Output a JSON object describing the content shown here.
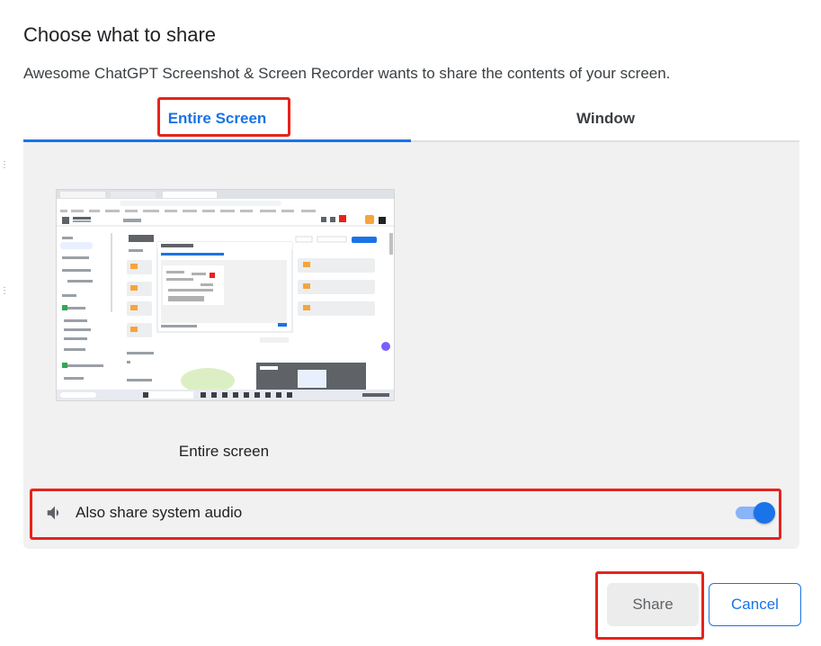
{
  "dialog": {
    "title": "Choose what to share",
    "subtitle": "Awesome ChatGPT Screenshot & Screen Recorder wants to share the contents of your screen."
  },
  "tabs": [
    {
      "label": "Entire Screen",
      "active": true
    },
    {
      "label": "Window",
      "active": false
    }
  ],
  "screen_source": {
    "label": "Entire screen"
  },
  "audio": {
    "label": "Also share system audio",
    "enabled": true,
    "icon": "speaker-icon"
  },
  "buttons": {
    "share": "Share",
    "cancel": "Cancel"
  },
  "colors": {
    "accent": "#1a73e8",
    "highlight": "#e8221b",
    "panel": "#f1f1f1"
  }
}
